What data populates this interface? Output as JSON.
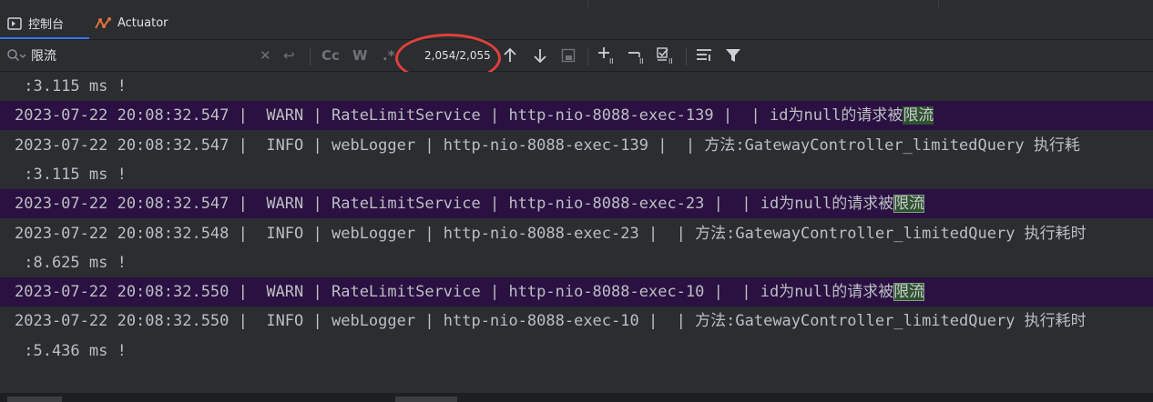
{
  "tabs": {
    "console_label": "控制台",
    "actuator_label": "Actuator"
  },
  "search": {
    "query": "限流",
    "match_case_label": "Cc",
    "words_label": "W",
    "regex_label": ".*",
    "match_counter": "2,054/2,055"
  },
  "colors": {
    "warn_row_bg": "#2a1141",
    "highlight_bg": "#2f5230",
    "circle": "#e0403a",
    "accent_tab": "#3574f0"
  },
  "log": {
    "lines": [
      {
        "pre": " :3.115 ms !",
        "hl": "",
        "post": ""
      },
      {
        "pre": "2023-07-22 20:08:32.547 |  WARN | RateLimitService | http-nio-8088-exec-139 |  | id为null的请求被",
        "hl": "限流",
        "post": ""
      },
      {
        "pre": "2023-07-22 20:08:32.547 |  INFO | webLogger | http-nio-8088-exec-139 |  | 方法:GatewayController_limitedQuery 执行耗",
        "hl": "",
        "post": ""
      },
      {
        "pre": " :3.115 ms !",
        "hl": "",
        "post": ""
      },
      {
        "pre": "2023-07-22 20:08:32.547 |  WARN | RateLimitService | http-nio-8088-exec-23 |  | id为null的请求被",
        "hl": "限流",
        "post": ""
      },
      {
        "pre": "2023-07-22 20:08:32.548 |  INFO | webLogger | http-nio-8088-exec-23 |  | 方法:GatewayController_limitedQuery 执行耗时",
        "hl": "",
        "post": ""
      },
      {
        "pre": " :8.625 ms !",
        "hl": "",
        "post": ""
      },
      {
        "pre": "2023-07-22 20:08:32.550 |  WARN | RateLimitService | http-nio-8088-exec-10 |  | id为null的请求被",
        "hl": "限流",
        "post": ""
      },
      {
        "pre": "2023-07-22 20:08:32.550 |  INFO | webLogger | http-nio-8088-exec-10 |  | 方法:GatewayController_limitedQuery 执行耗时",
        "hl": "",
        "post": ""
      },
      {
        "pre": " :5.436 ms !",
        "hl": "",
        "post": ""
      }
    ]
  }
}
